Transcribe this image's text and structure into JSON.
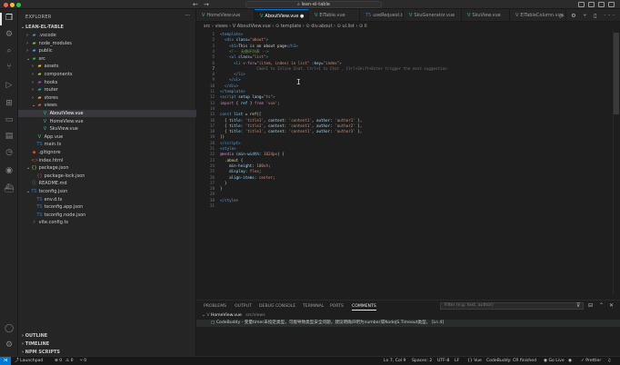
{
  "window": {
    "title": "lean-el-table",
    "nav_back": "←",
    "nav_forward": "→"
  },
  "activity_bar": {
    "items": [
      {
        "name": "explorer-icon",
        "glyph": "❐"
      },
      {
        "name": "settings-sync-icon",
        "glyph": "⚙"
      },
      {
        "name": "search-icon",
        "glyph": "⌕"
      },
      {
        "name": "source-control-icon",
        "glyph": "⑂"
      },
      {
        "name": "run-debug-icon",
        "glyph": "▷"
      },
      {
        "name": "extensions-icon",
        "glyph": "⊞"
      },
      {
        "name": "remote-explorer-icon",
        "glyph": "▭"
      },
      {
        "name": "folder-icon",
        "glyph": "▤"
      },
      {
        "name": "timeline-icon",
        "glyph": "◷"
      },
      {
        "name": "copilot-icon",
        "glyph": "◉"
      },
      {
        "name": "docker-icon",
        "glyph": "⛴"
      }
    ],
    "bottom": [
      {
        "name": "account-icon",
        "glyph": "◯"
      },
      {
        "name": "manage-gear-icon",
        "glyph": "⚙"
      }
    ]
  },
  "explorer": {
    "title": "EXPLORER",
    "more": "···",
    "root": "LEAN-EL-TABLE",
    "tree": [
      {
        "label": ".vscode",
        "depth": 1,
        "chev": "›",
        "icon": "▰",
        "color": "#519aba"
      },
      {
        "label": "node_modules",
        "depth": 1,
        "chev": "›",
        "icon": "▰",
        "color": "#8bc34a"
      },
      {
        "label": "public",
        "depth": 1,
        "chev": "›",
        "icon": "▰",
        "color": "#42a5f5"
      },
      {
        "label": "src",
        "depth": 1,
        "chev": "⌄",
        "icon": "▰",
        "color": "#4caf50"
      },
      {
        "label": "assets",
        "depth": 2,
        "chev": "›",
        "icon": "▰",
        "color": "#ffca28"
      },
      {
        "label": "components",
        "depth": 2,
        "chev": "›",
        "icon": "▰",
        "color": "#c0ca33"
      },
      {
        "label": "hooks",
        "depth": 2,
        "chev": "›",
        "icon": "▰",
        "color": "#ab47bc"
      },
      {
        "label": "router",
        "depth": 2,
        "chev": "›",
        "icon": "▰",
        "color": "#26a69a"
      },
      {
        "label": "stores",
        "depth": 2,
        "chev": "›",
        "icon": "▰",
        "color": "#ffa726"
      },
      {
        "label": "views",
        "depth": 2,
        "chev": "⌄",
        "icon": "▰",
        "color": "#ef5350"
      },
      {
        "label": "AboutView.vue",
        "depth": 3,
        "chev": "",
        "icon": "V",
        "color": "#41b883",
        "selected": true
      },
      {
        "label": "HomeView.vue",
        "depth": 3,
        "chev": "",
        "icon": "V",
        "color": "#41b883"
      },
      {
        "label": "SkuView.vue",
        "depth": 3,
        "chev": "",
        "icon": "V",
        "color": "#41b883"
      },
      {
        "label": "App.vue",
        "depth": 2,
        "chev": "",
        "icon": "V",
        "color": "#41b883"
      },
      {
        "label": "main.ts",
        "depth": 2,
        "chev": "",
        "icon": "TS",
        "color": "#3178c6"
      },
      {
        "label": ".gitignore",
        "depth": 1,
        "chev": "",
        "icon": "◆",
        "color": "#e64a19"
      },
      {
        "label": "index.html",
        "depth": 1,
        "chev": "",
        "icon": "<>",
        "color": "#e44d26"
      },
      {
        "label": "package.json",
        "depth": 1,
        "chev": "⌄",
        "icon": "{}",
        "color": "#8bc34a"
      },
      {
        "label": "package-lock.json",
        "depth": 2,
        "chev": "",
        "icon": "{}",
        "color": "#cb3837"
      },
      {
        "label": "README.md",
        "depth": 1,
        "chev": "",
        "icon": "ⓘ",
        "color": "#42a5f5"
      },
      {
        "label": "tsconfig.json",
        "depth": 1,
        "chev": "⌄",
        "icon": "TS",
        "color": "#3178c6"
      },
      {
        "label": "env.d.ts",
        "depth": 2,
        "chev": "",
        "icon": "TS",
        "color": "#3178c6"
      },
      {
        "label": "tsconfig.app.json",
        "depth": 2,
        "chev": "",
        "icon": "TS",
        "color": "#3178c6"
      },
      {
        "label": "tsconfig.node.json",
        "depth": 2,
        "chev": "",
        "icon": "TS",
        "color": "#3178c6"
      },
      {
        "label": "vite.config.ts",
        "depth": 1,
        "chev": "",
        "icon": "⚡",
        "color": "#ab47bc"
      }
    ],
    "sections": [
      "OUTLINE",
      "TIMELINE",
      "NPM SCRIPTS"
    ]
  },
  "tabs": [
    {
      "label": "HomeView.vue",
      "kind": "vue"
    },
    {
      "label": "AboutView.vue",
      "kind": "vue",
      "active": true,
      "modified": "●"
    },
    {
      "label": "ElTable.vue",
      "kind": "vue"
    },
    {
      "label": "useRequest.ts",
      "kind": "ts"
    },
    {
      "label": "SkuGenerator.vue",
      "kind": "vue"
    },
    {
      "label": "SkuView.vue",
      "kind": "vue"
    },
    {
      "label": "ElTableColumn.vue",
      "kind": "vue"
    }
  ],
  "tab_actions": "▷ ⚙ ⑂ ▯ ···",
  "breadcrumb": "src › views › V AboutView.vue › ⊙ template › ⊙ div.about › ⊙ ul.list › ⊙ li",
  "code_lines": [
    {
      "n": "1",
      "html": "<span class='tg'>&lt;template&gt;</span>"
    },
    {
      "n": "2",
      "html": "  <span class='tg'>&lt;div</span> <span class='at'>class</span>=<span class='st'>\"about\"</span><span class='tg'>&gt;</span>"
    },
    {
      "n": "3",
      "html": "    <span class='tg'>&lt;h1&gt;</span>This is an about page<span class='tg'>&lt;/h1&gt;</span>"
    },
    {
      "n": "4",
      "html": "    <span class='cm'>&lt;!-- 无循环列表 --&gt;</span>"
    },
    {
      "n": "5",
      "html": "    <span class='tg'>&lt;ul</span> <span class='at'>class</span>=<span class='st'>\"list\"</span><span class='tg'>&gt;</span>"
    },
    {
      "n": "6",
      "html": "      <span class='tg'>&lt;li</span> <span class='kw'>v-for</span>=<span class='st'>\"(item, index) in list\"</span> <span class='at'>:key</span>=<span class='st'>\"index\"</span><span class='tg'>&gt;</span>"
    },
    {
      "n": "7",
      "html": "                <span class='ghost'>Cmd+I to Inline Chat, Ctrl+I to Chat , Ctrl+Shift+Enter trigger the next suggestion</span>"
    },
    {
      "n": "8",
      "html": "      <span class='tg'>&lt;/li&gt;</span>"
    },
    {
      "n": "9",
      "html": "    <span class='tg'>&lt;/ul&gt;</span>"
    },
    {
      "n": "10",
      "html": "  <span class='tg'>&lt;/div&gt;</span>"
    },
    {
      "n": "11",
      "html": "<span class='tg'>&lt;/template&gt;</span>"
    },
    {
      "n": "12",
      "html": "<span class='tg'>&lt;script</span> <span class='at'>setup</span> <span class='at'>lang</span>=<span class='st'>\"ts\"</span><span class='tg'>&gt;</span>"
    },
    {
      "n": "13",
      "html": "<span class='kw'>import</span> { <span class='at'>ref</span> } <span class='kw'>from</span> <span class='st'>'vue'</span>;"
    },
    {
      "n": "14",
      "html": ""
    },
    {
      "n": "15",
      "html": "<span class='tg'>const</span> <span class='at'>list</span> = <span class='fn'>ref</span>(["
    },
    {
      "n": "16",
      "html": "  { <span class='at'>title</span>: <span class='st'>'title1'</span>, <span class='at'>content</span>: <span class='st'>'content1'</span>, <span class='at'>author</span>: <span class='st'>'author1'</span> },"
    },
    {
      "n": "17",
      "html": "  { <span class='at'>title</span>: <span class='st'>'title1'</span>, <span class='at'>content</span>: <span class='st'>'content1'</span>, <span class='at'>author</span>: <span class='st'>'author2'</span> },"
    },
    {
      "n": "18",
      "html": "  { <span class='at'>title</span>: <span class='st'>'title1'</span>, <span class='at'>content</span>: <span class='st'>'content1'</span>, <span class='at'>author</span>: <span class='st'>'author3'</span> },"
    },
    {
      "n": "19",
      "html": "])"
    },
    {
      "n": "20",
      "html": "<span class='tg'>&lt;/script&gt;</span>"
    },
    {
      "n": "21",
      "html": "<span class='tg'>&lt;style&gt;</span>"
    },
    {
      "n": "22",
      "html": "<span class='kw'>@media</span> (<span class='at'>min-width</span>: <span class='st'>1024px</span>) {"
    },
    {
      "n": "23",
      "html": "  <span class='fn'>.about</span> {"
    },
    {
      "n": "24",
      "html": "    <span class='at'>min-height</span>: <span class='st'>100vh</span>;"
    },
    {
      "n": "25",
      "html": "    <span class='at'>display</span>: <span class='st'>flex</span>;"
    },
    {
      "n": "26",
      "html": "    <span class='at'>align-items</span>: <span class='st'>center</span>;"
    },
    {
      "n": "27",
      "html": "  }"
    },
    {
      "n": "28",
      "html": "}"
    },
    {
      "n": "29",
      "html": ""
    },
    {
      "n": "30",
      "html": "<span class='tg'>&lt;/style&gt;</span>"
    },
    {
      "n": "31",
      "html": ""
    }
  ],
  "panel": {
    "tabs": [
      "PROBLEMS",
      "OUTPUT",
      "DEBUG CONSOLE",
      "TERMINAL",
      "PORTS",
      "COMMENTS"
    ],
    "active_tab": "COMMENTS",
    "filter_placeholder": "Filter (e.g. text, author)",
    "file": "HomeView.vue",
    "file_path": "src/views",
    "comment": "CodeBuddy - 变量timer未指定类型，可能导致类型安全问题，建议明确声明为number或NodeJS.Timeout类型。 [Ln 4]"
  },
  "statusbar": {
    "launchpad": "Launchpad",
    "errors": "⊗ 0",
    "warnings": "⚠ 0",
    "ports": "⑂ 0",
    "position": "Ln 7, Col 9",
    "spaces": "Spaces: 2",
    "encoding": "UTF-8",
    "eol": "LF",
    "language": "{} Vue",
    "codebuddy": "CodeBuddy: CR finished",
    "golive": "◉ Go Live",
    "prettier": "✓ Prettier"
  }
}
